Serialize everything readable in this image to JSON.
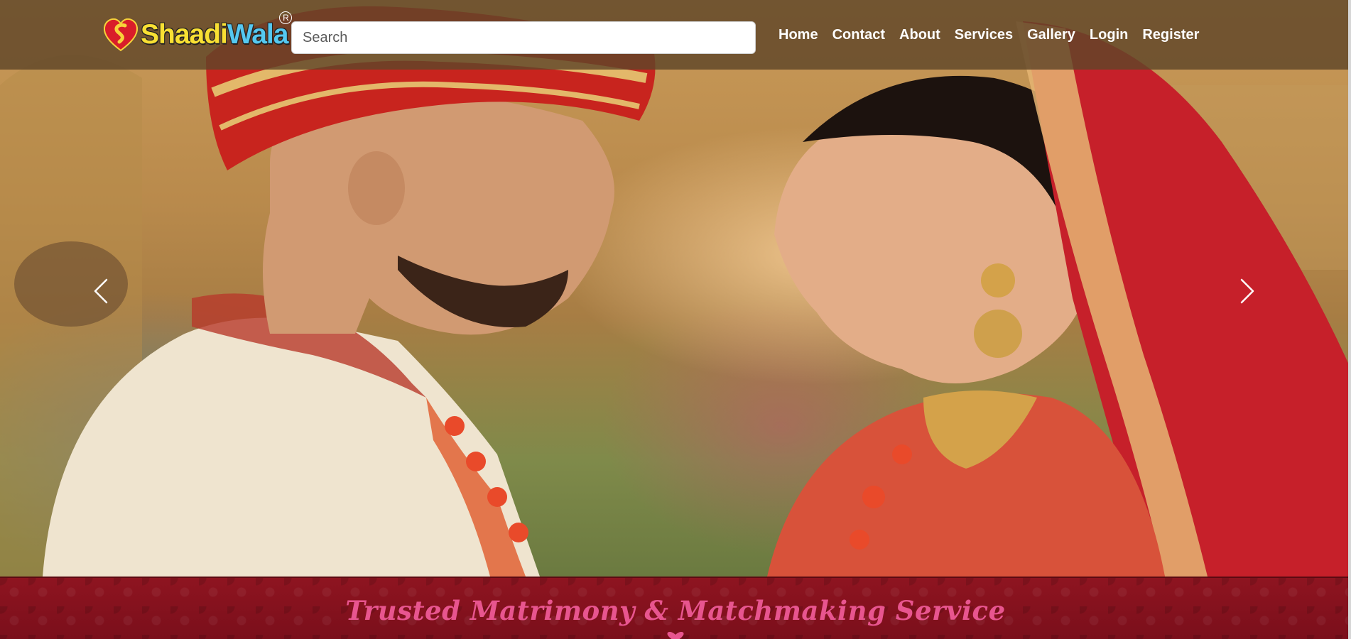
{
  "brand": {
    "name_part1": "Shaadi",
    "name_part2": "Wala",
    "registered_mark": "R",
    "colors": {
      "part1": "#f9e033",
      "part2": "#55c8f0",
      "heart": "#d91d2a"
    }
  },
  "search": {
    "placeholder": "Search",
    "value": ""
  },
  "nav": {
    "links": [
      {
        "label": "Home"
      },
      {
        "label": "Contact"
      },
      {
        "label": "About"
      },
      {
        "label": "Services"
      },
      {
        "label": "Gallery"
      },
      {
        "label": "Login"
      },
      {
        "label": "Register"
      }
    ]
  },
  "carousel": {
    "prev_icon": "chevron-left-icon",
    "next_icon": "chevron-right-icon",
    "slide_description_icon": "hero-photo"
  },
  "banner": {
    "tagline": "Trusted Matrimony & Matchmaking Service",
    "colors": {
      "background": "#8e1420",
      "text": "#e8558f"
    }
  }
}
